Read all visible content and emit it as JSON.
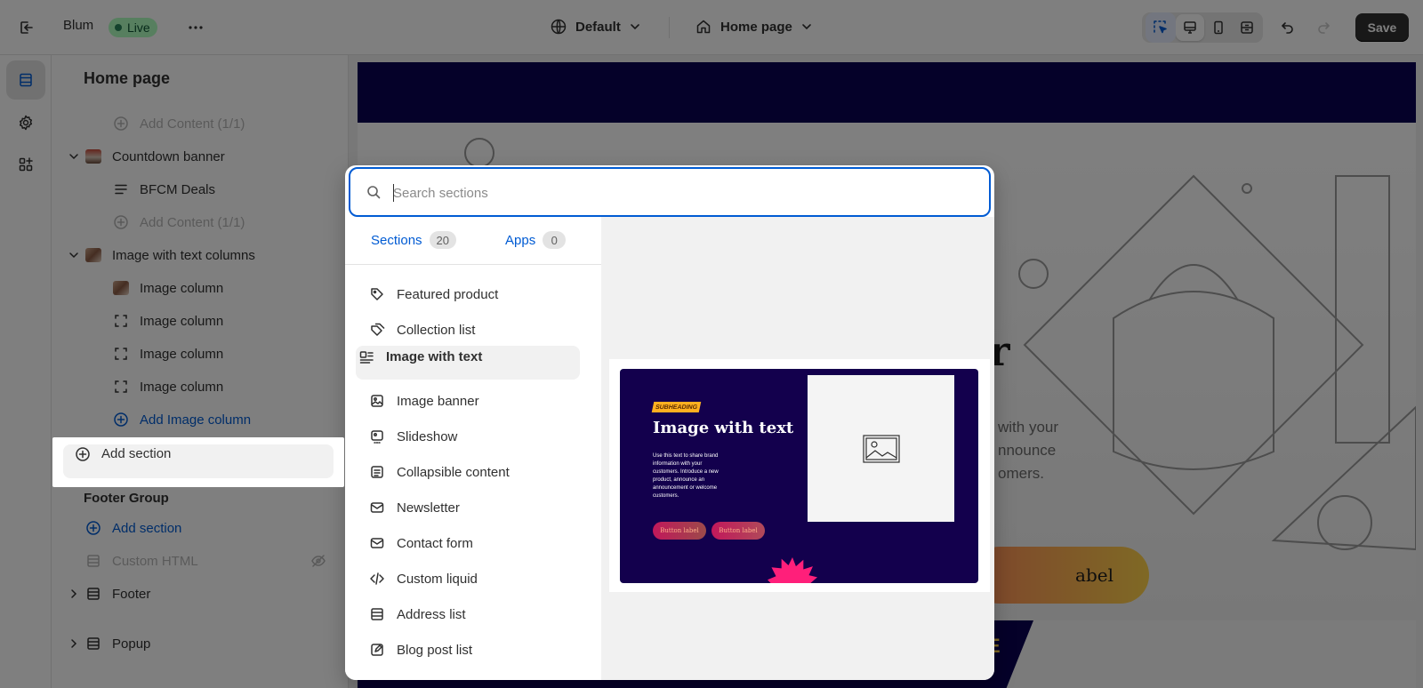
{
  "topbar": {
    "store_name": "Blum",
    "status_badge": "Live",
    "theme_select": "Default",
    "page_select": "Home page",
    "save_label": "Save"
  },
  "sidebar": {
    "title": "Home page",
    "add_content_1": "Add Content (1/1)",
    "countdown_banner": "Countdown banner",
    "bfcm_deals": "BFCM Deals",
    "add_content_2": "Add Content (1/1)",
    "image_with_text_columns": "Image with text columns",
    "image_column_1": "Image column",
    "image_column_2": "Image column",
    "image_column_3": "Image column",
    "image_column_4": "Image column",
    "add_image_column": "Add Image column",
    "add_section": "Add section",
    "footer_group_label": "Footer Group",
    "footer_add_section": "Add section",
    "custom_html": "Custom HTML",
    "footer": "Footer",
    "popup": "Popup"
  },
  "picker": {
    "search_placeholder": "Search sections",
    "tabs": [
      {
        "label": "Sections",
        "count": "20"
      },
      {
        "label": "Apps",
        "count": "0"
      }
    ],
    "items": [
      {
        "label": "Featured product",
        "icon": "tag-icon"
      },
      {
        "label": "Collection list",
        "icon": "tags-icon"
      },
      {
        "label": "Image with text",
        "icon": "image-with-text-icon"
      },
      {
        "label": "Image banner",
        "icon": "image-banner-icon"
      },
      {
        "label": "Slideshow",
        "icon": "slideshow-icon"
      },
      {
        "label": "Collapsible content",
        "icon": "collapsible-icon"
      },
      {
        "label": "Newsletter",
        "icon": "envelope-icon"
      },
      {
        "label": "Contact form",
        "icon": "envelope-icon"
      },
      {
        "label": "Custom liquid",
        "icon": "code-icon"
      },
      {
        "label": "Address list",
        "icon": "list-icon"
      },
      {
        "label": "Blog post list",
        "icon": "blog-icon"
      }
    ],
    "preview": {
      "subheading": "SUBHEADING",
      "title": "Image with text",
      "body": "Use this text to share brand information with your customers. Introduce a new product, announce an announcement or welcome customers.",
      "button_1": "Button label",
      "button_2": "Button label"
    }
  },
  "storefront": {
    "hero_title_fragment": "er",
    "hero_text_fragment": "with your\nnnounce\nomers.",
    "hero_button_fragment": "abel",
    "promo_fragment": "E"
  },
  "colors": {
    "accent": "#005bd3",
    "navy": "#0a0253",
    "save_button": "#303030",
    "live_badge": "#affebf"
  }
}
